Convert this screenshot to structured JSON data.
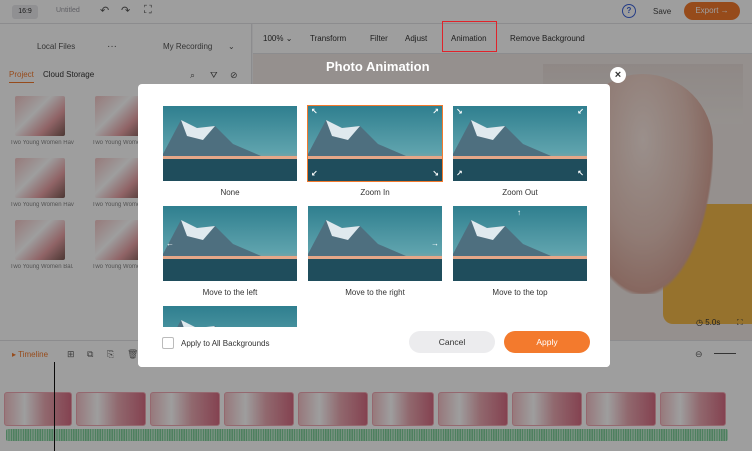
{
  "topbar": {
    "ratio": "16:9",
    "title": "Untitled",
    "undo_icon": "undo-icon",
    "redo_icon": "redo-icon",
    "fullscreen_icon": "fullscreen-icon",
    "help": "?",
    "save": "Save",
    "export": "Export"
  },
  "media_panel": {
    "tabs": [
      "Local Files",
      "My Recording"
    ],
    "sub_tabs": [
      "Project",
      "Cloud Storage"
    ],
    "thumb_captions": [
      "Two Young Women Hav...",
      "Two Young Women Hav...",
      "Two Young Women Hav...",
      "Two Young Women Hav...",
      "Two Young Women Bal...",
      "Two Young Women Hav..."
    ]
  },
  "edit_toolbar": {
    "zoom": "100%",
    "items": [
      "Transform",
      "Filter",
      "Adjust",
      "Animation",
      "Remove Background"
    ]
  },
  "preview": {
    "duration": "5.0s"
  },
  "timeline": {
    "label": "Timeline"
  },
  "modal": {
    "title": "Photo Animation",
    "options": [
      {
        "label": "None",
        "selected": false
      },
      {
        "label": "Zoom In",
        "selected": true
      },
      {
        "label": "Zoom Out",
        "selected": false
      },
      {
        "label": "Move to the left",
        "selected": false
      },
      {
        "label": "Move to the right",
        "selected": false
      },
      {
        "label": "Move to the top",
        "selected": false
      },
      {
        "label": "",
        "selected": false
      }
    ],
    "apply_all_label": "Apply to All Backgrounds",
    "cancel": "Cancel",
    "apply": "Apply"
  },
  "colors": {
    "accent": "#f37a2d",
    "highlight": "#e0232a"
  }
}
